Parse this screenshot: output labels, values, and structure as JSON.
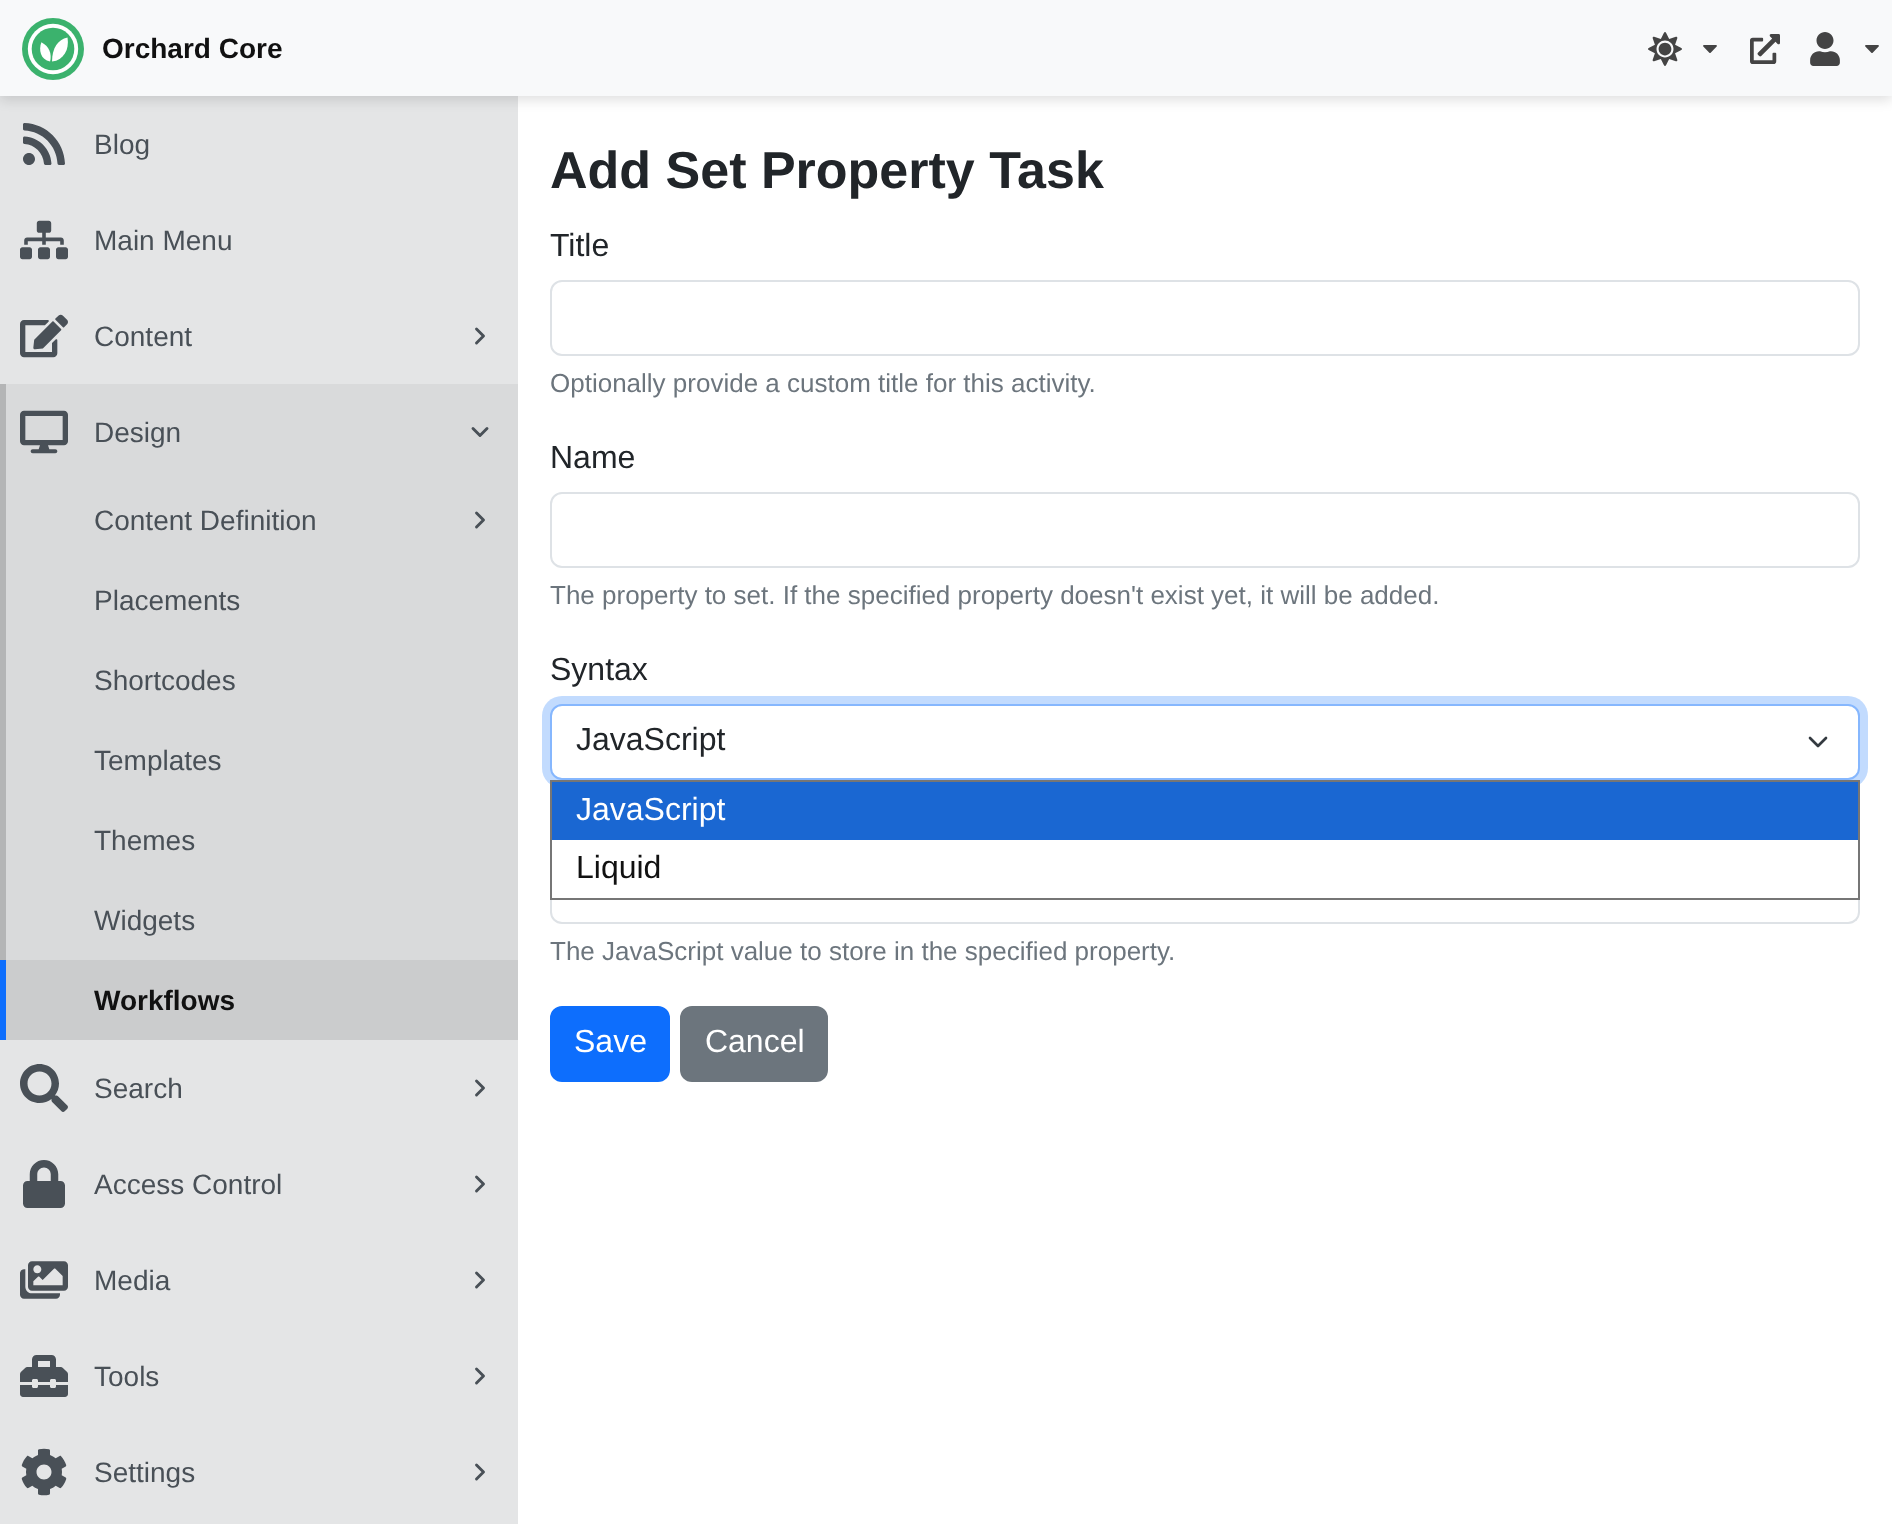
{
  "header": {
    "brand": "Orchard Core"
  },
  "sidebar": {
    "items": [
      {
        "label": "Blog",
        "selected": false
      },
      {
        "label": "Main Menu",
        "selected": false
      },
      {
        "label": "Content",
        "selected": false,
        "expanded": false
      },
      {
        "label": "Design",
        "selected": false,
        "expanded": true,
        "children": [
          {
            "label": "Content Definition",
            "selected": false,
            "expanded": false
          },
          {
            "label": "Placements",
            "selected": false
          },
          {
            "label": "Shortcodes",
            "selected": false
          },
          {
            "label": "Templates",
            "selected": false
          },
          {
            "label": "Themes",
            "selected": false
          },
          {
            "label": "Widgets",
            "selected": false
          },
          {
            "label": "Workflows",
            "selected": true
          }
        ]
      },
      {
        "label": "Search",
        "selected": false,
        "expanded": false
      },
      {
        "label": "Access Control",
        "selected": false,
        "expanded": false
      },
      {
        "label": "Media",
        "selected": false,
        "expanded": false
      },
      {
        "label": "Tools",
        "selected": false,
        "expanded": false
      },
      {
        "label": "Settings",
        "selected": false,
        "expanded": false
      }
    ]
  },
  "page": {
    "title": "Add Set Property Task"
  },
  "form": {
    "fields": [
      {
        "kind": "text",
        "label": "Title",
        "help": "Optionally provide a custom title for this activity."
      },
      {
        "kind": "text",
        "label": "Name",
        "help": "The property to set. If the specified property doesn't exist yet, it will be added."
      },
      {
        "kind": "select",
        "label": "Syntax",
        "value": "JavaScript",
        "expanded": true,
        "options": [
          {
            "label": "JavaScript",
            "selected": true
          },
          {
            "label": "Liquid",
            "selected": false
          }
        ]
      },
      {
        "kind": "obscured",
        "help": "The JavaScript value to store in the specified property."
      }
    ],
    "buttons": [
      {
        "label": "Save",
        "kind": "primary"
      },
      {
        "label": "Cancel",
        "kind": "secondary"
      }
    ]
  }
}
